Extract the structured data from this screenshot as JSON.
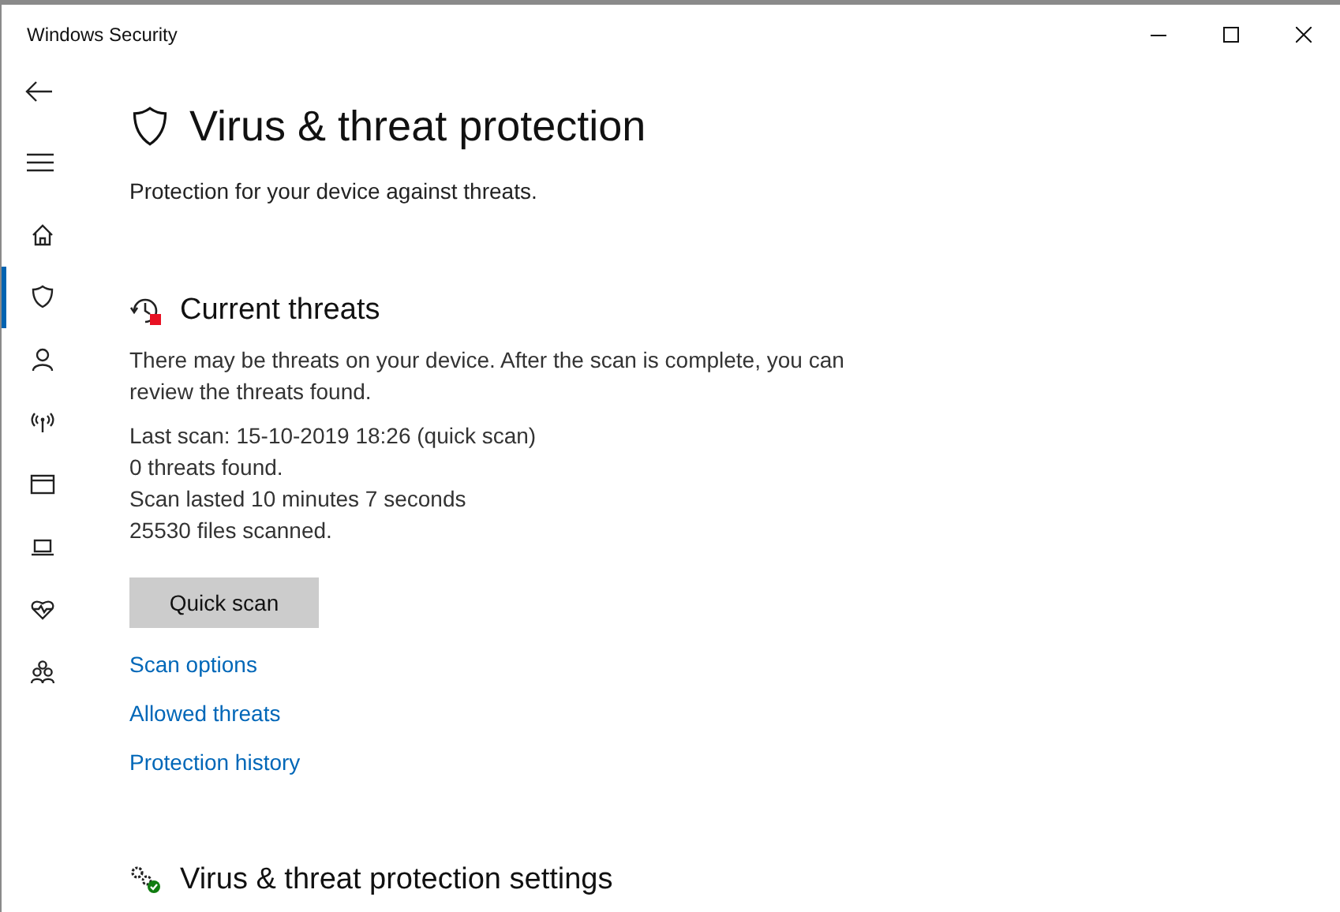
{
  "window": {
    "title": "Windows Security"
  },
  "sidebar": {
    "items": [
      {
        "selected": false
      },
      {
        "selected": true
      },
      {
        "selected": false
      },
      {
        "selected": false
      },
      {
        "selected": false
      },
      {
        "selected": false
      },
      {
        "selected": false
      },
      {
        "selected": false
      }
    ]
  },
  "page": {
    "title": "Virus & threat protection",
    "subtitle": "Protection for your device against threats."
  },
  "current_threats": {
    "title": "Current threats",
    "description": "There may be threats on your device. After the scan is complete, you can review the threats found.",
    "details": [
      "Last scan: 15-10-2019 18:26 (quick scan)",
      "0 threats found.",
      "Scan lasted 10 minutes 7 seconds",
      "25530 files scanned."
    ],
    "button": "Quick scan",
    "links": [
      "Scan options",
      "Allowed threats",
      "Protection history"
    ]
  },
  "settings": {
    "title": "Virus & threat protection settings"
  }
}
